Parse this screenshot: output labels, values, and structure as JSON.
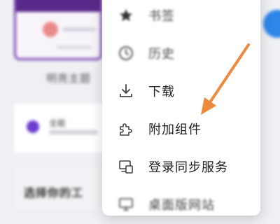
{
  "background": {
    "card_caption": "明亮主题",
    "row_title": "全能",
    "section_title": "选择你的工"
  },
  "menu": {
    "items": [
      {
        "label": "书签",
        "icon": "star-icon"
      },
      {
        "label": "历史",
        "icon": "history-clock-icon"
      },
      {
        "label": "下载",
        "icon": "download-icon"
      },
      {
        "label": "附加组件",
        "icon": "puzzle-icon"
      },
      {
        "label": "登录同步服务",
        "icon": "sync-devices-icon"
      },
      {
        "label": "桌面版网站",
        "icon": "desktop-icon"
      }
    ]
  },
  "colors": {
    "arrow": "#ee8a3a",
    "accent_purple": "#6a3ccf",
    "menu_bg": "#ffffff"
  }
}
